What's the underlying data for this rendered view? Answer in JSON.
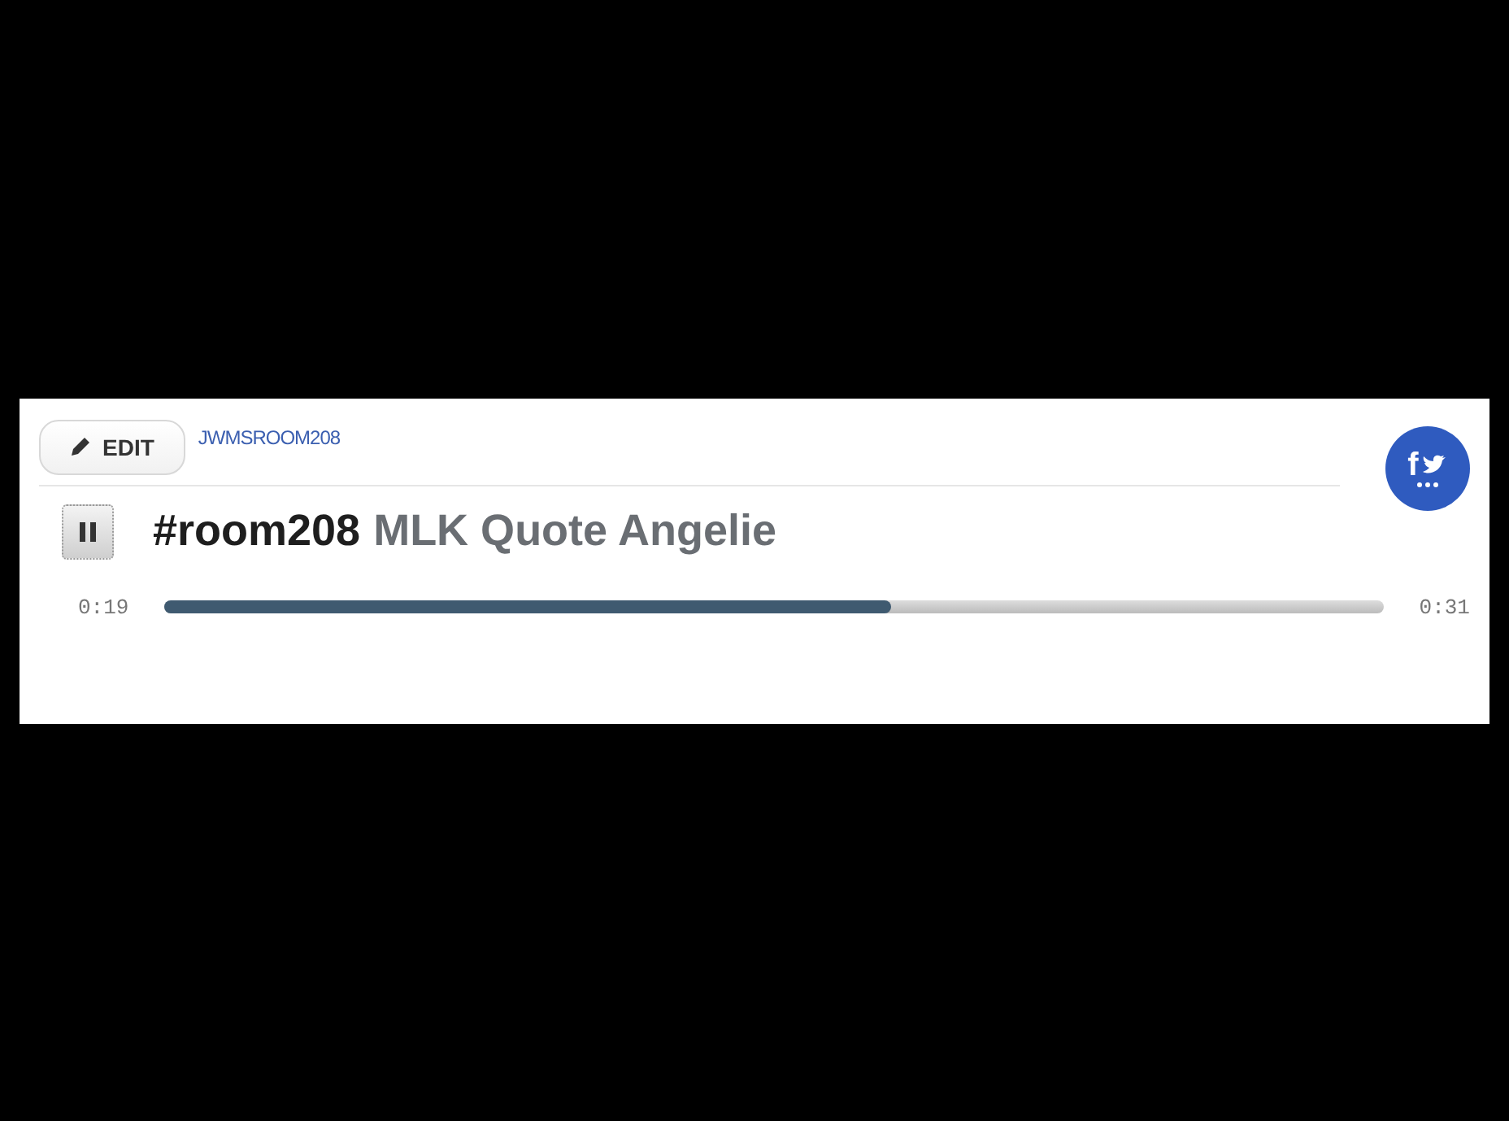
{
  "player": {
    "edit_button": "EDIT",
    "username": "JWMSROOM208",
    "share_button": "f",
    "tag": "#room208",
    "title": "MLK Quote Angelie",
    "playing": true,
    "elapsed": "0:19",
    "duration": "0:31",
    "level": 0.596
  }
}
